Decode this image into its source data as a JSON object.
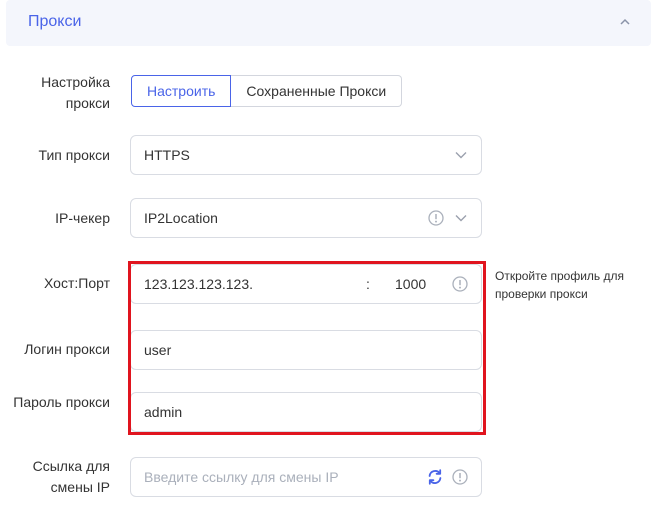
{
  "section": {
    "title": "Прокси",
    "collapse_icon": "chevron-up-icon"
  },
  "proxy_setup": {
    "label": "Настройка прокси",
    "options": [
      "Настроить",
      "Сохраненные Прокси"
    ],
    "selected": "Настроить"
  },
  "proxy_type": {
    "label": "Тип прокси",
    "value": "HTTPS",
    "icon": "chevron-down-icon"
  },
  "ip_checker": {
    "label": "IP-чекер",
    "value": "IP2Location",
    "icons": [
      "info-icon",
      "chevron-down-icon"
    ]
  },
  "host_port": {
    "label": "Хост:Порт",
    "host": "123.123.123.123.",
    "separator": ":",
    "port": "1000",
    "icon": "info-icon",
    "hint": "Откройте профиль для проверки прокси"
  },
  "login": {
    "label": "Логин прокси",
    "value": "user"
  },
  "password": {
    "label": "Пароль прокси",
    "value": "admin"
  },
  "change_ip_link": {
    "label": "Ссылка для смены IP",
    "placeholder": "Введите ссылку для смены IP",
    "icons": [
      "refresh-icon",
      "info-icon"
    ]
  },
  "colors": {
    "accent": "#4a64e8",
    "highlight": "#e0141e",
    "border": "#d9dce3"
  }
}
